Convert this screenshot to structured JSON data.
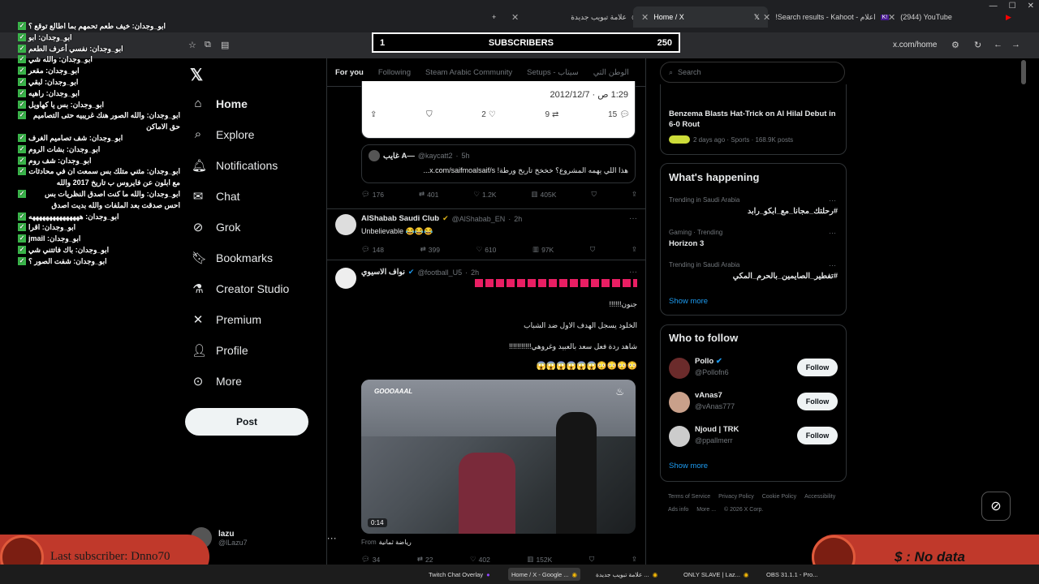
{
  "browser": {
    "tabs": [
      {
        "title": "علامة تبويب جديدة"
      },
      {
        "title": "Home / X"
      },
      {
        "title": "!Search results - Kahoot - اعلام"
      },
      {
        "title": "(2944) YouTube"
      }
    ],
    "url": "x.com/home"
  },
  "subscribers": {
    "current": "1",
    "label": "SUBSCRIBERS",
    "goal": "250"
  },
  "nav": {
    "items": [
      {
        "label": "Home",
        "icon": "home-icon"
      },
      {
        "label": "Explore",
        "icon": "search-icon"
      },
      {
        "label": "Notifications",
        "icon": "bell-icon"
      },
      {
        "label": "Chat",
        "icon": "mail-icon"
      },
      {
        "label": "Grok",
        "icon": "grok-icon"
      },
      {
        "label": "Bookmarks",
        "icon": "bookmark-icon"
      },
      {
        "label": "Creator Studio",
        "icon": "flask-icon"
      },
      {
        "label": "Premium",
        "icon": "x-icon"
      },
      {
        "label": "Profile",
        "icon": "person-icon"
      },
      {
        "label": "More",
        "icon": "more-circle-icon"
      }
    ],
    "post_label": "Post",
    "user_name": "lazu",
    "user_handle": "@lLazu7"
  },
  "feed": {
    "tabs": [
      "For you",
      "Following",
      "Steam Arabic Community",
      "Setups - سيتاب",
      "الوطن التي"
    ],
    "quoted": {
      "date": "1:29 ص · 2012/12/7",
      "replies": "15",
      "reposts": "9",
      "likes": "2"
    },
    "quote_reply": {
      "name": "غايب A—",
      "handle": "@kaycatt2",
      "time": "5h",
      "text": "هذا اللي يهمه المشروع؟ خخخخ تاريخ ورطة! x.com/saifmoalsaif/s...",
      "replies": "176",
      "reposts": "401",
      "likes": "1.2K",
      "views": "405K"
    },
    "tweet2": {
      "name": "AlShabab Saudi Club",
      "handle": "@AlShabab_EN",
      "time": "2h",
      "text": "Unbelievable 😂😂😂",
      "replies": "148",
      "reposts": "399",
      "likes": "610",
      "views": "97K"
    },
    "tweet3": {
      "name": "نواف الاسيوي",
      "handle": "@football_U5",
      "time": "2h",
      "lines": [
        "جنون!!!!!!",
        "الخلود يسجل الهدف الاول ضد الشباب",
        "شاهد ردة فعل سعد بالعبيد وغروهي!!!!!!!!!!!"
      ],
      "emoji_line": "😳😳😳😳😱😱😱😱😱😱",
      "video_caption": "GOOOAAAL",
      "video_time": "0:14",
      "from": "رياضة ثمانية",
      "replies": "34",
      "reposts": "22",
      "likes": "402",
      "views": "152K"
    }
  },
  "right": {
    "search_placeholder": "Search",
    "top_trend": {
      "title": "Benzema Blasts Hat-Trick on Al Hilal Debut in 6-0 Rout",
      "meta": "2 days ago · Sports · 168.9K posts"
    },
    "whats_happening": {
      "title": "What's happening",
      "trends": [
        {
          "context": "Trending in Saudi Arabia",
          "name": "#رحلتك_مجانا_مع_ابكو_رابد"
        },
        {
          "context": "Gaming · Trending",
          "name": "Horizon 3"
        },
        {
          "context": "Trending in Saudi Arabia",
          "name": "#تفطير_الصايمين_بالحرم_المكي"
        }
      ],
      "show_more": "Show more"
    },
    "who_to_follow": {
      "title": "Who to follow",
      "users": [
        {
          "name": "Pollo",
          "handle": "@Pollofn6"
        },
        {
          "name": "vAnas7",
          "handle": "@vAnas777"
        },
        {
          "name": "Njoud | TRK",
          "handle": "@ppallmerr"
        }
      ],
      "follow_label": "Follow",
      "show_more": "Show more"
    },
    "footer": [
      "Terms of Service",
      "Privacy Policy",
      "Cookie Policy",
      "Accessibility",
      "Ads info",
      "More ...",
      "© 2026 X Corp."
    ]
  },
  "chat": [
    "ابو_وجدان: خيف طعم تحمهم بما اطالع توقع ؟",
    "ابو_وجدان: ابو",
    "ابو_وجدان: نفسي أعرف الطعم",
    "ابو_وجدان: والله شي",
    "ابو_وجدان: مقعر",
    "ابو_وجدان: لبقي",
    "ابو_وجدان: راهيه",
    "ابو_وجدان: بس يا كهاويل",
    "ابو_وجدان: والله الصور هنك غريبيه حتى التصاميم حق الاماكن",
    "ابو_وجدان: شف تصاميم الغرف",
    "ابو_وجدان: بشات الروم",
    "ابو_وجدان: شف روم",
    "ابو_وجدان: مثني متلك بس سمعت ان في محادثات مع ابلون عن فايروس ب تاريخ 2017 والله",
    "ابو_وجدان: والله ما كنت اصدق النظريات بس احس صدقت بعد الملفات والله بديت اصدق",
    "ابو_وجدان: هههههههههههههههه",
    "ابو_وجدان: اقرا",
    "ابو_وجدان: jmail",
    "ابو_وجدان: باك فاتتني شي",
    "ابو_وجدان: شفت الصور ؟"
  ],
  "overlay": {
    "last_subscriber": "Last subscriber: Dnno70",
    "donation": "$ : No data"
  },
  "taskbar": [
    "Twitch Chat Overlay",
    "Home / X - Google ...",
    "علامة تبويب جديدة ...",
    "ONLY SLAVE | Laz...",
    "OBS 31.1.1 - Pro..."
  ]
}
